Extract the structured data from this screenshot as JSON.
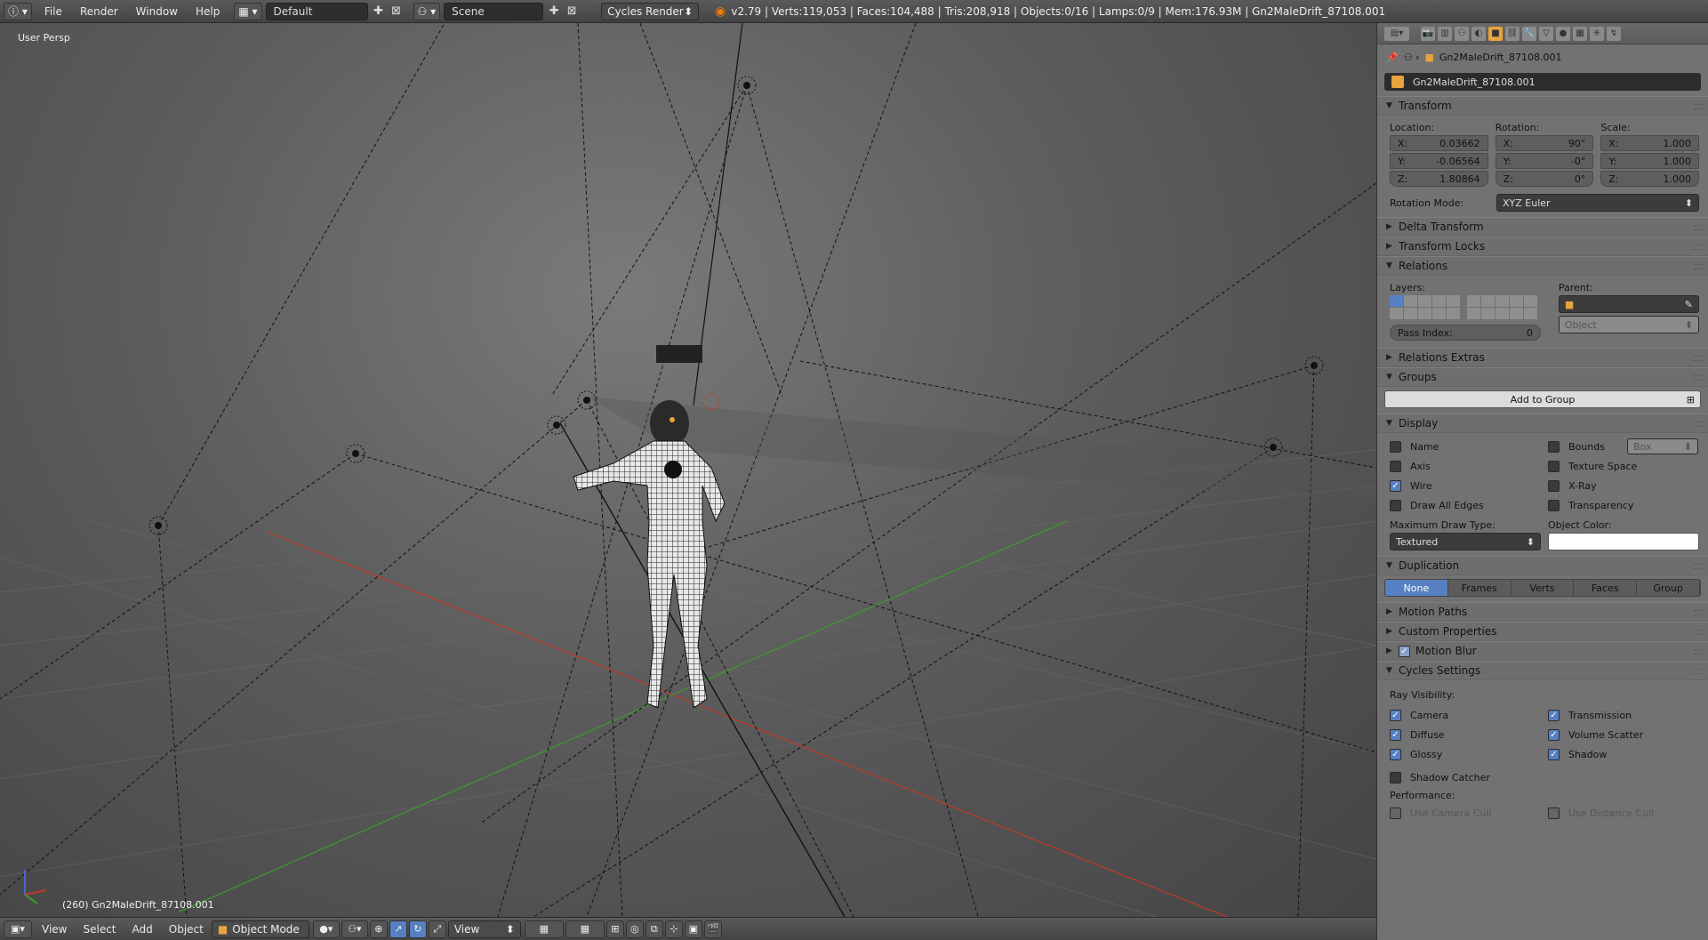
{
  "topbar": {
    "menus": [
      "File",
      "Render",
      "Window",
      "Help"
    ],
    "layout_name": "Default",
    "scene_name": "Scene",
    "engine": "Cycles Render",
    "stats": "v2.79 | Verts:119,053 | Faces:104,488 | Tris:208,918 | Objects:0/16 | Lamps:0/9 | Mem:176.93M | Gn2MaleDrift_87108.001"
  },
  "viewport": {
    "view_label": "User Persp",
    "object_label": "(260) Gn2MaleDrift_87108.001"
  },
  "bottombar": {
    "menus": [
      "View",
      "Select",
      "Add",
      "Object"
    ],
    "mode": "Object Mode",
    "view_dropdown": "View"
  },
  "properties": {
    "path_object": "Gn2MaleDrift_87108.001",
    "object_name": "Gn2MaleDrift_87108.001",
    "transform": {
      "title": "Transform",
      "location_label": "Location:",
      "rotation_label": "Rotation:",
      "scale_label": "Scale:",
      "location": {
        "x": "0.03662",
        "y": "-0.06564",
        "z": "1.80864"
      },
      "rotation": {
        "x": "90°",
        "y": "-0°",
        "z": "0°"
      },
      "scale": {
        "x": "1.000",
        "y": "1.000",
        "z": "1.000"
      },
      "rotation_mode_label": "Rotation Mode:",
      "rotation_mode": "XYZ Euler"
    },
    "delta_transform": "Delta Transform",
    "transform_locks": "Transform Locks",
    "relations": {
      "title": "Relations",
      "layers_label": "Layers:",
      "parent_label": "Parent:",
      "parent_type": "Object",
      "pass_index_label": "Pass Index:",
      "pass_index": "0"
    },
    "relations_extras": "Relations Extras",
    "groups": {
      "title": "Groups",
      "add_button": "Add to Group"
    },
    "display": {
      "title": "Display",
      "name": "Name",
      "axis": "Axis",
      "wire": "Wire",
      "draw_all_edges": "Draw All Edges",
      "bounds": "Bounds",
      "bounds_type": "Box",
      "texture_space": "Texture Space",
      "xray": "X-Ray",
      "transparency": "Transparency",
      "max_draw_type_label": "Maximum Draw Type:",
      "max_draw_type": "Textured",
      "object_color_label": "Object Color:",
      "object_color": "#ffffff"
    },
    "duplication": {
      "title": "Duplication",
      "options": [
        "None",
        "Frames",
        "Verts",
        "Faces",
        "Group"
      ],
      "selected": "None"
    },
    "motion_paths": "Motion Paths",
    "custom_properties": "Custom Properties",
    "motion_blur": "Motion Blur",
    "cycles": {
      "title": "Cycles Settings",
      "ray_visibility_label": "Ray Visibility:",
      "camera": "Camera",
      "diffuse": "Diffuse",
      "glossy": "Glossy",
      "transmission": "Transmission",
      "volume_scatter": "Volume Scatter",
      "shadow": "Shadow",
      "shadow_catcher": "Shadow Catcher",
      "performance_label": "Performance:",
      "use_camera_cull": "Use Camera Cull",
      "use_distance_cull": "Use Distance Cull"
    }
  },
  "colors": {
    "accent": "#5680c2",
    "object_orange": "#e8a33c",
    "x_axis": "#c0392b",
    "y_axis": "#3f9a2f"
  }
}
